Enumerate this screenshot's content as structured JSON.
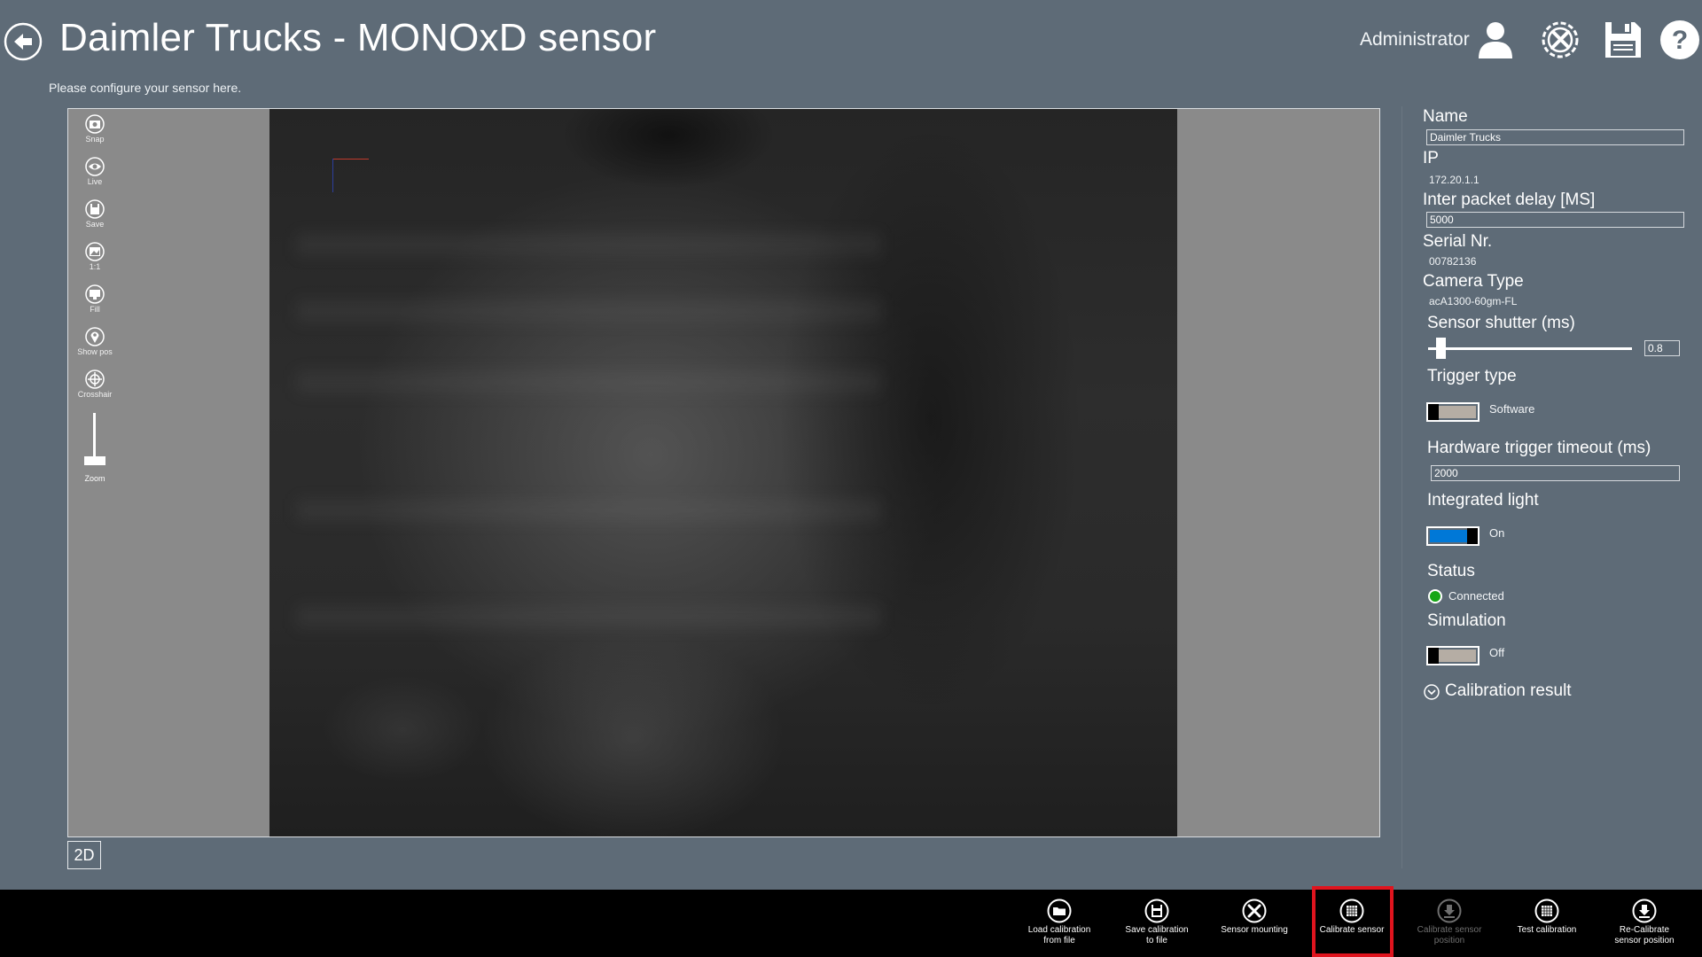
{
  "header": {
    "title": "Daimler Trucks - MONOxD sensor",
    "subtitle": "Please configure your sensor here.",
    "user": "Administrator"
  },
  "viewer": {
    "tools": [
      {
        "label": "Snap",
        "icon": "camera-icon"
      },
      {
        "label": "Live",
        "icon": "eye-icon"
      },
      {
        "label": "Save",
        "icon": "floppy-icon"
      },
      {
        "label": "1:1",
        "icon": "image-icon"
      },
      {
        "label": "Fill",
        "icon": "monitor-icon"
      },
      {
        "label": "Show pos",
        "icon": "map-pin-icon"
      },
      {
        "label": "Crosshair",
        "icon": "crosshair-icon"
      }
    ],
    "zoom_label": "Zoom",
    "mode_button": "2D"
  },
  "settings": {
    "name_label": "Name",
    "name_value": "Daimler Trucks",
    "ip_label": "IP",
    "ip_value": "172.20.1.1",
    "inter_packet_label": "Inter packet delay [MS]",
    "inter_packet_value": "5000",
    "serial_label": "Serial Nr.",
    "serial_value": "00782136",
    "camera_type_label": "Camera Type",
    "camera_type_value": "acA1300-60gm-FL",
    "shutter_label": "Sensor shutter (ms)",
    "shutter_value": "0.8",
    "trigger_type_label": "Trigger type",
    "trigger_type_value": "Software",
    "hw_timeout_label": "Hardware trigger timeout (ms)",
    "hw_timeout_value": "2000",
    "light_label": "Integrated light",
    "light_value": "On",
    "status_label": "Status",
    "status_value": "Connected",
    "simulation_label": "Simulation",
    "simulation_value": "Off",
    "calibration_result_label": "Calibration result"
  },
  "appbar": {
    "buttons": [
      {
        "label1": "Load calibration",
        "label2": "from file",
        "icon": "folder-icon",
        "enabled": true
      },
      {
        "label1": "Save calibration",
        "label2": "to file",
        "icon": "floppy-icon",
        "enabled": true
      },
      {
        "label1": "Sensor mounting",
        "label2": "",
        "icon": "tools-icon",
        "enabled": true
      },
      {
        "label1": "Calibrate sensor",
        "label2": "",
        "icon": "grid-icon",
        "enabled": true
      },
      {
        "label1": "Calibrate sensor",
        "label2": "position",
        "icon": "download-icon",
        "enabled": false
      },
      {
        "label1": "Test calibration",
        "label2": "",
        "icon": "grid-icon",
        "enabled": true
      },
      {
        "label1": "Re-Calibrate",
        "label2": "sensor position",
        "icon": "download-icon",
        "enabled": true
      }
    ]
  },
  "colors": {
    "background": "#5e6b77",
    "accent": "#0078d7",
    "status_connected": "#16a616",
    "highlight": "#e0141e"
  }
}
